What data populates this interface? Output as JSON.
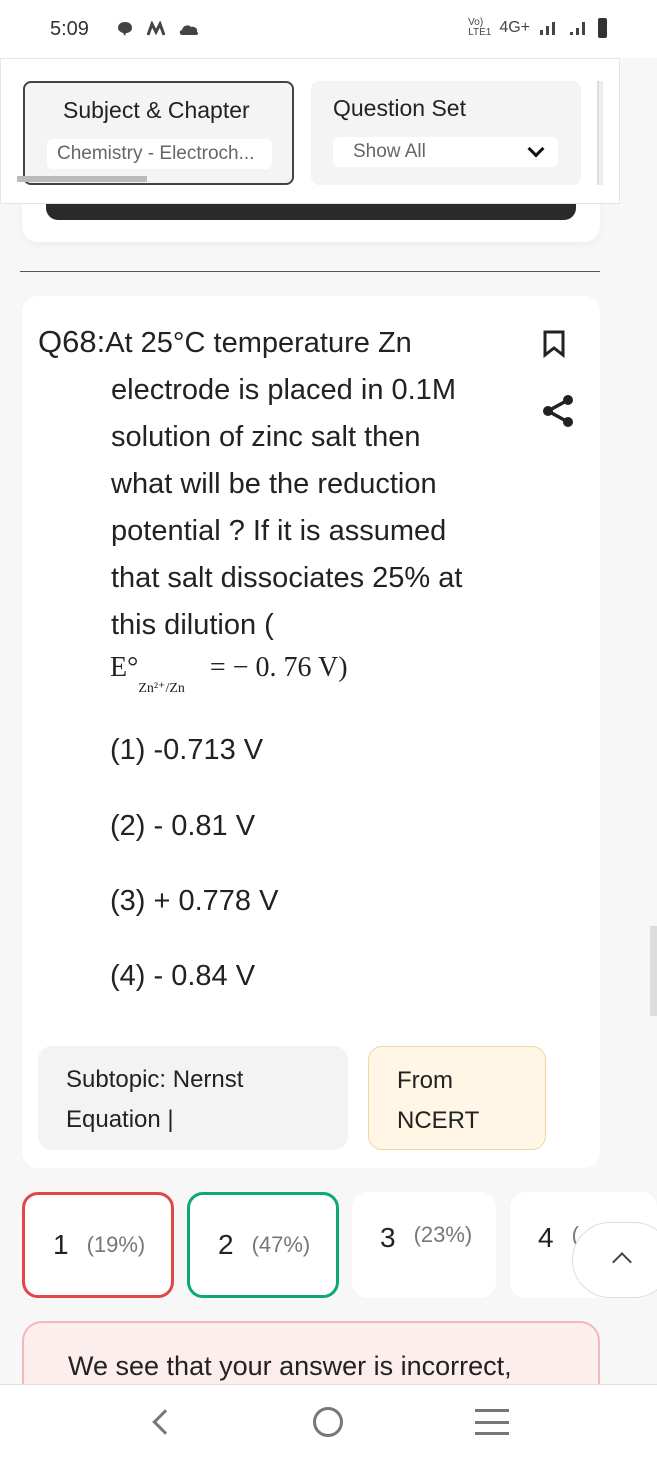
{
  "status_bar": {
    "time": "5:09",
    "left_icons": [
      "chat-icon",
      "m-icon",
      "cloud-icon"
    ],
    "network": "4G+",
    "volte": "VoLTE1"
  },
  "filters": {
    "subject": {
      "title": "Subject & Chapter",
      "value": "Chemistry - Electroch..."
    },
    "question_set": {
      "title": "Question Set",
      "value": "Show All"
    }
  },
  "question": {
    "number": "Q68:",
    "lines": [
      "At 25°C temperature Zn",
      "electrode is placed in 0.1M",
      "solution of zinc salt then",
      "what will be the reduction",
      "potential ? If it is assumed",
      "that salt dissociates 25% at",
      "this dilution ("
    ],
    "formula": {
      "symbol": "E°",
      "subscript": "Zn²⁺/Zn",
      "rhs": "=  − 0. 76 V)"
    },
    "options": [
      "(1) -0.713 V",
      "(2) - 0.81 V",
      "(3) + 0.778 V",
      "(4) - 0.84 V"
    ],
    "subtopic_label": "Subtopic:  Nernst",
    "subtopic_line2": "Equation |",
    "source_line1": "From",
    "source_line2": "NCERT"
  },
  "answers": [
    {
      "option": "1",
      "percent": "(19%)",
      "state": "incorrect-selected"
    },
    {
      "option": "2",
      "percent": "(47%)",
      "state": "correct"
    },
    {
      "option": "3",
      "percent": "(23%)",
      "state": "neutral"
    },
    {
      "option": "4",
      "percent": "(",
      "state": "neutral"
    }
  ],
  "colors": {
    "incorrect": "#e04848",
    "correct": "#0da779",
    "ncert_bg": "#fff6e5",
    "feedback_bg": "#fdeeee"
  },
  "feedback": {
    "text": "We see that your answer is incorrect,"
  }
}
